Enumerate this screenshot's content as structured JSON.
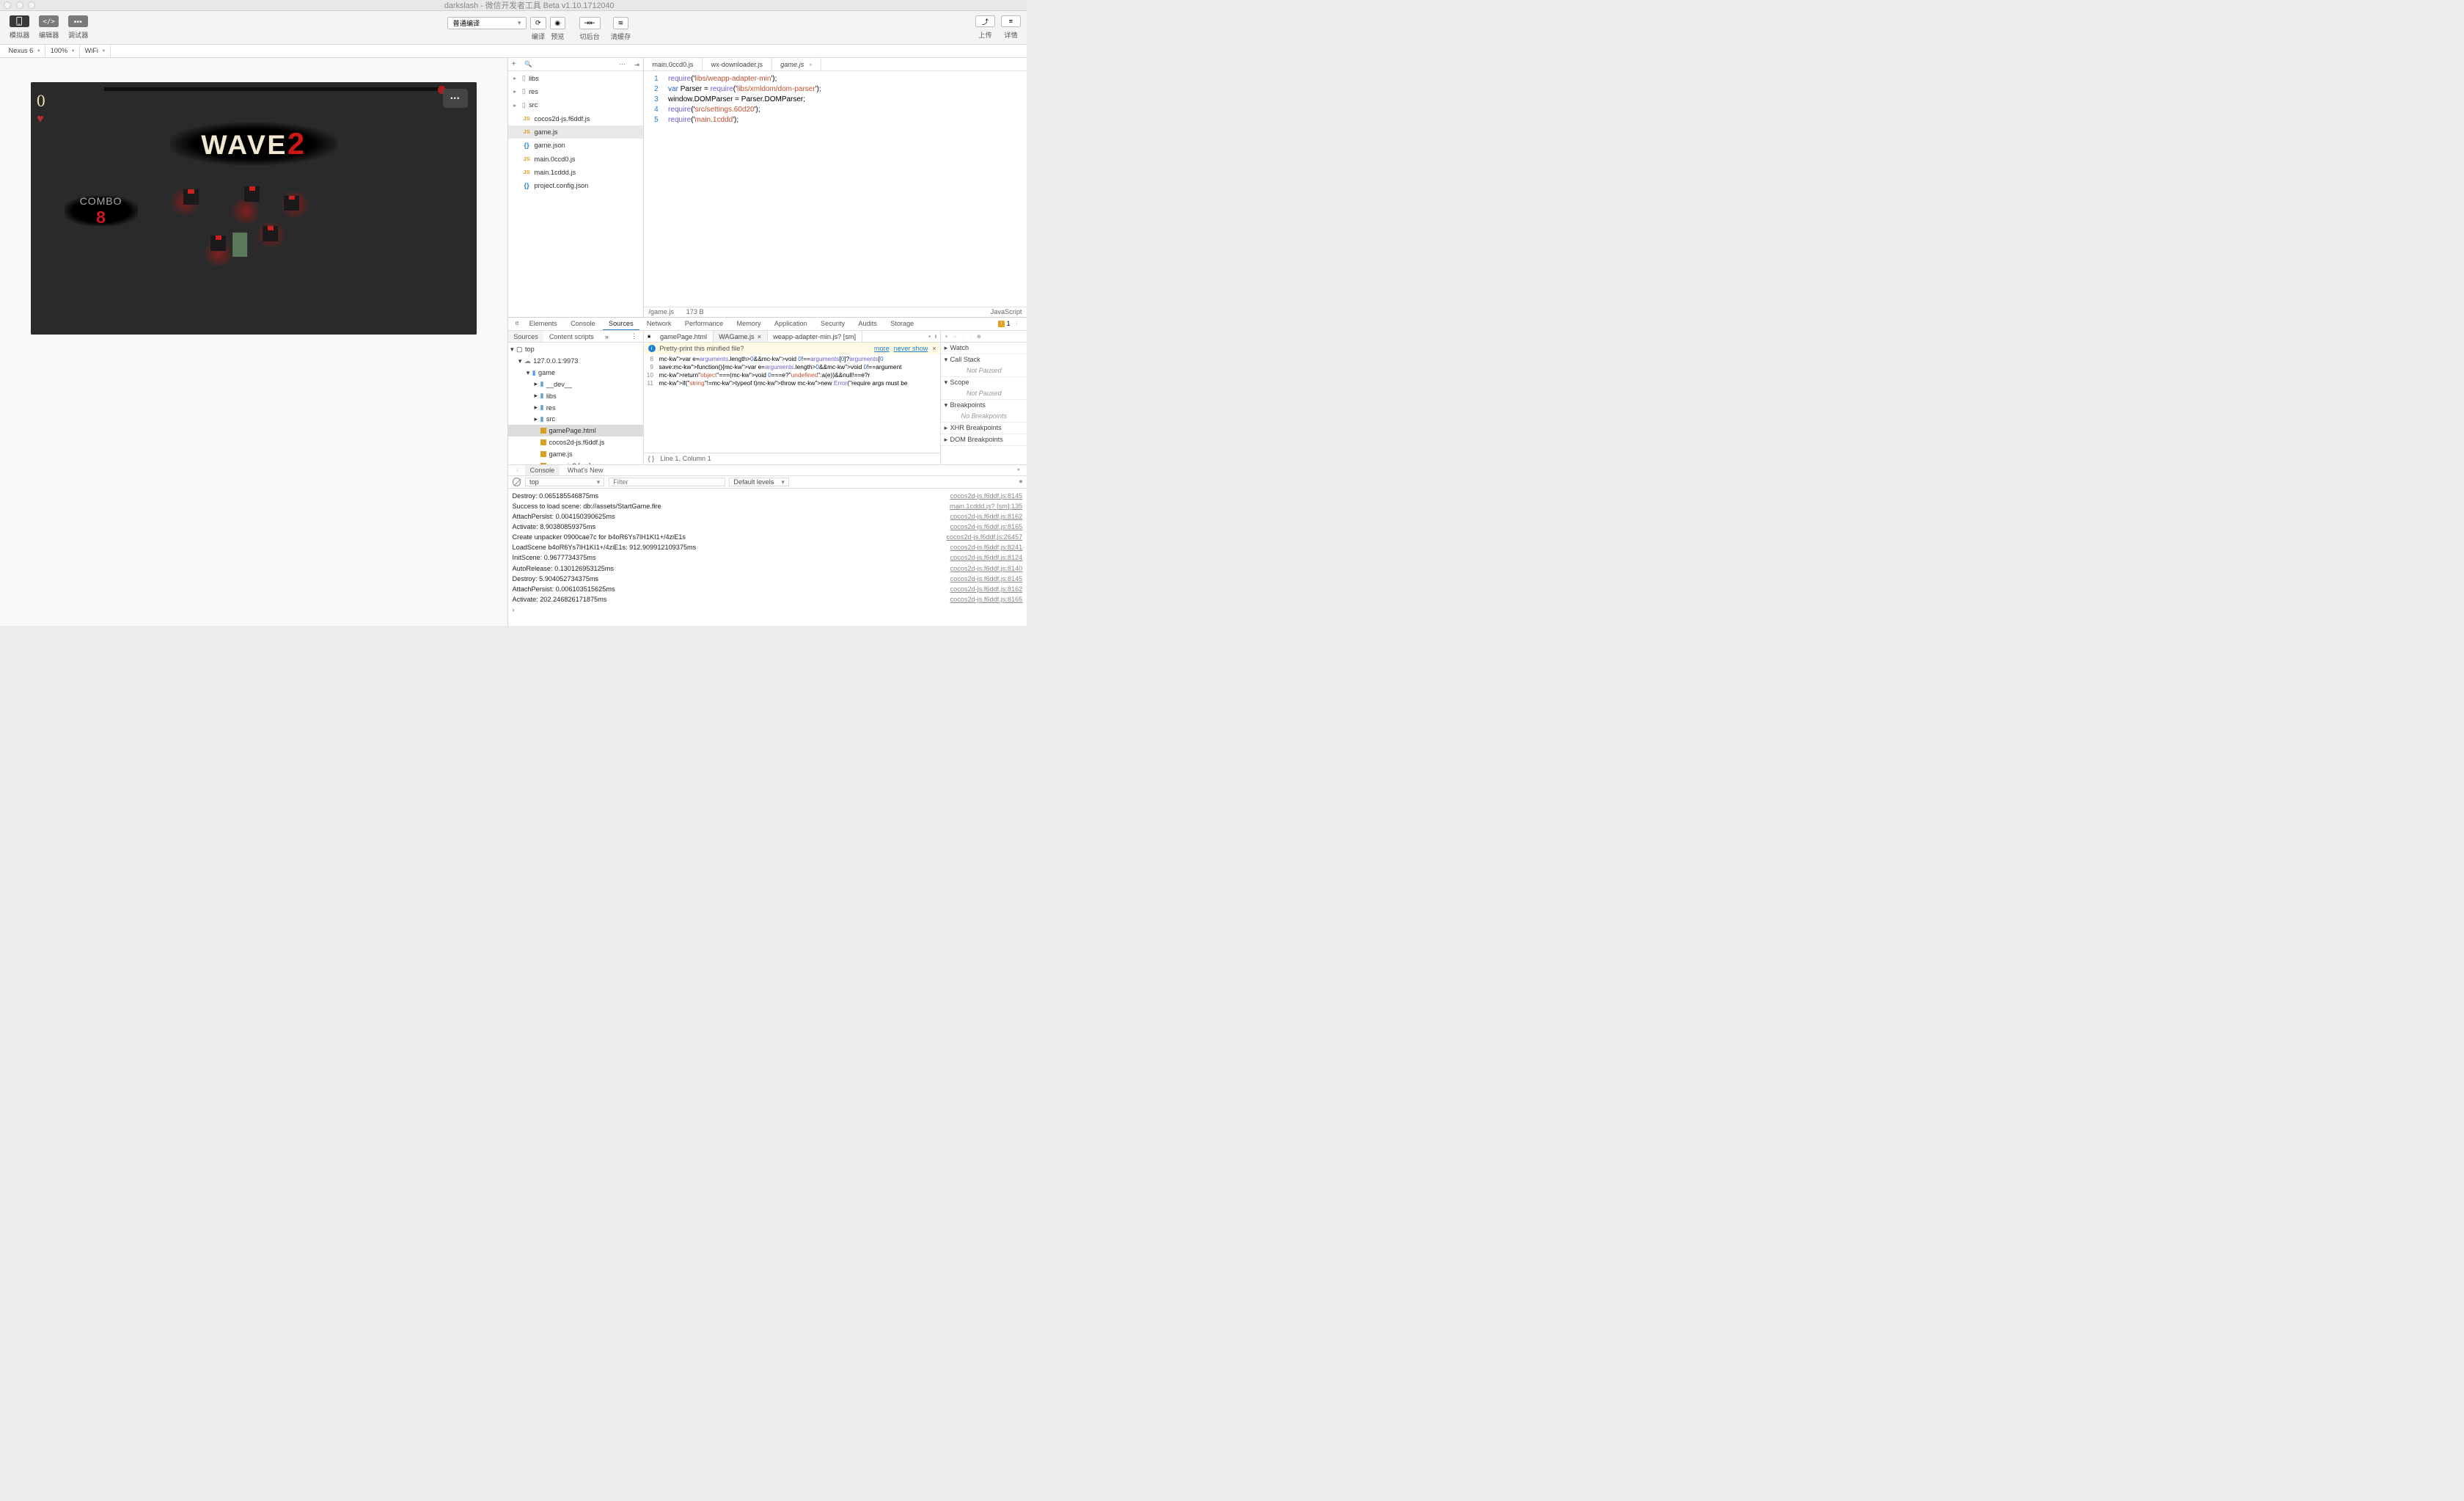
{
  "windowTitle": "darkslash - 微信开发者工具 Beta v1.10.1712040",
  "toolbar": {
    "simulator": "模拟器",
    "editor": "编辑器",
    "debugger": "调试器",
    "compile_mode": "普通编译",
    "compile": "编译",
    "preview": "预览",
    "background": "切后台",
    "clear_cache": "清缓存",
    "upload": "上传",
    "details": "详情"
  },
  "device": {
    "name": "Nexus 6",
    "zoom": "100%",
    "network": "WiFi"
  },
  "game": {
    "score": "0",
    "wave_label": "WAVE",
    "wave_num": "2",
    "combo_label": "COMBO",
    "combo_num": "8"
  },
  "fileTree": {
    "folders": [
      "libs",
      "res",
      "src"
    ],
    "files": [
      {
        "name": "cocos2d-js.f6ddf.js",
        "type": "js"
      },
      {
        "name": "game.js",
        "type": "js",
        "selected": true
      },
      {
        "name": "game.json",
        "type": "json"
      },
      {
        "name": "main.0ccd0.js",
        "type": "js"
      },
      {
        "name": "main.1cddd.js",
        "type": "js"
      },
      {
        "name": "project.config.json",
        "type": "json"
      }
    ]
  },
  "editorTabs": [
    "main.0ccd0.js",
    "wx-downloader.js",
    "game.js"
  ],
  "code": {
    "lines": [
      "require('libs/weapp-adapter-min');",
      "var Parser = require('libs/xmldom/dom-parser');",
      "window.DOMParser = Parser.DOMParser;",
      "require('src/settings.60d20');",
      "require('main.1cddd');"
    ]
  },
  "status": {
    "path": "/game.js",
    "size": "173 B",
    "lang": "JavaScript"
  },
  "devtools": {
    "tabs": [
      "Elements",
      "Console",
      "Sources",
      "Network",
      "Performance",
      "Memory",
      "Application",
      "Security",
      "Audits",
      "Storage"
    ],
    "warn_count": "1",
    "subtabs": [
      "Sources",
      "Content scripts"
    ],
    "tree": {
      "top": "top",
      "host": "127.0.0.1:9973",
      "game": "game",
      "folders": [
        "__dev__",
        "libs",
        "res",
        "src"
      ],
      "files": [
        "gamePage.html",
        "cocos2d-js.f6ddf.js",
        "game.js",
        "game.js? [sm]"
      ],
      "selected": "gamePage.html"
    },
    "fileTabs": [
      {
        "name": "gamePage.html"
      },
      {
        "name": "WAGame.js",
        "active": true
      },
      {
        "name": "weapp-adapter-min.js? [sm]"
      }
    ],
    "pretty": {
      "msg": "Pretty-print this minified file?",
      "more": "more",
      "never": "never show"
    },
    "miniLines": [
      "var e=arguments.length>0&&void 0!==arguments[0]?arguments[0",
      "save:function(){var e=arguments.length>0&&void 0!==argument",
      "return\"object\"===(void 0===e?\"undefined\":a(e))&&null!==e?r",
      "if(\"string\"!=typeof t)throw new Error(\"require args must be"
    ],
    "miniLinesStart": 8,
    "srcStatus": "Line 1, Column 1",
    "debug": {
      "sections": [
        "Watch",
        "Call Stack",
        "Scope",
        "Breakpoints",
        "XHR Breakpoints",
        "DOM Breakpoints"
      ],
      "not_paused": "Not Paused",
      "no_breakpoints": "No Breakpoints"
    }
  },
  "consoleTabs": [
    "Console",
    "What's New"
  ],
  "consoleToolbar": {
    "context": "top",
    "filter_ph": "Filter",
    "levels": "Default levels"
  },
  "console": [
    {
      "msg": "Destroy: 0.065185546875ms",
      "src": "cocos2d-js.f6ddf.js:8145"
    },
    {
      "msg": "Success to load scene: db://assets/StartGame.fire",
      "src": "main.1cddd.js? [sm]:135"
    },
    {
      "msg": "AttachPersist: 0.004150390625ms",
      "src": "cocos2d-js.f6ddf.js:8162"
    },
    {
      "msg": "Activate: 8.90380859375ms",
      "src": "cocos2d-js.f6ddf.js:8165"
    },
    {
      "msg": "Create unpacker 0900cae7c for b4oR6Ys7lH1KI1+/4ziE1s",
      "src": "cocos2d-js.f6ddf.js:26457"
    },
    {
      "msg": "LoadScene b4oR6Ys7lH1KI1+/4ziE1s: 912.909912109375ms",
      "src": "cocos2d-js.f6ddf.js:8241"
    },
    {
      "msg": "InitScene: 0.9677734375ms",
      "src": "cocos2d-js.f6ddf.js:8124"
    },
    {
      "msg": "AutoRelease: 0.130126953125ms",
      "src": "cocos2d-js.f6ddf.js:8140"
    },
    {
      "msg": "Destroy: 5.904052734375ms",
      "src": "cocos2d-js.f6ddf.js:8145"
    },
    {
      "msg": "AttachPersist: 0.006103515625ms",
      "src": "cocos2d-js.f6ddf.js:8162"
    },
    {
      "msg": "Activate: 202.246826171875ms",
      "src": "cocos2d-js.f6ddf.js:8165"
    }
  ]
}
